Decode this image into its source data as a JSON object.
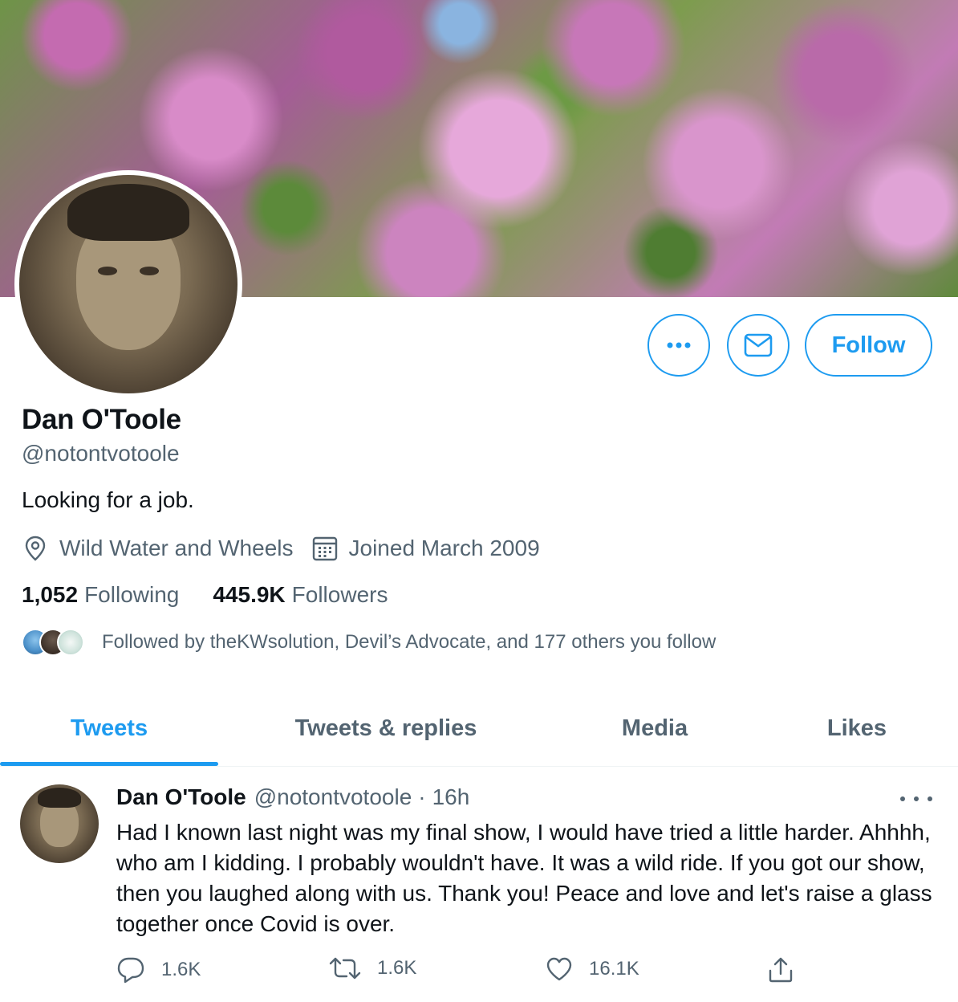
{
  "profile": {
    "name": "Dan O'Toole",
    "handle": "@notontvotoole",
    "bio": "Looking for a job.",
    "location": "Wild Water and Wheels",
    "joined": "Joined March 2009",
    "following_count": "1,052",
    "following_label": "Following",
    "followers_count": "445.9K",
    "followers_label": "Followers",
    "followed_by": "Followed by theKWsolution, Devil’s Advocate, and 177 others you follow"
  },
  "actions": {
    "follow_label": "Follow"
  },
  "tabs": [
    {
      "label": "Tweets",
      "active": true
    },
    {
      "label": "Tweets & replies",
      "active": false
    },
    {
      "label": "Media",
      "active": false
    },
    {
      "label": "Likes",
      "active": false
    }
  ],
  "tweet": {
    "name": "Dan O'Toole",
    "handle": "@notontvotoole",
    "separator": "·",
    "time": "16h",
    "text": "Had I known last night was my final show, I would have tried a little harder. Ahhhh, who am I kidding. I probably wouldn't have. It was a wild ride. If you got our show, then you laughed along with us. Thank you! Peace and love and let's raise a glass together once Covid is over.",
    "replies": "1.6K",
    "retweets": "1.6K",
    "likes": "16.1K"
  },
  "colors": {
    "accent": "#1d9bf0",
    "text_primary": "#0f1419",
    "text_secondary": "#536471"
  }
}
